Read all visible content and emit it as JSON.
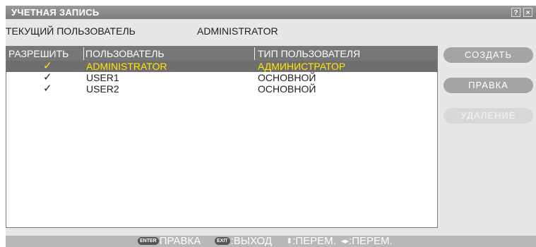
{
  "window": {
    "title": "УЧЕТНАЯ ЗАПИСЬ",
    "help_icon": "?",
    "close_icon": "×"
  },
  "current_user": {
    "label": "ТЕКУЩИЙ ПОЛЬЗОВАТЕЛЬ",
    "value": "ADMINISTRATOR"
  },
  "table": {
    "headers": [
      "РАЗРЕШИТЬ",
      "ПОЛЬЗОВАТЕЛЬ",
      "ТИП ПОЛЬЗОВАТЕЛЯ"
    ],
    "rows": [
      {
        "enabled": "✓",
        "user": "ADMINISTRATOR",
        "type": "АДМИНИСТРАТОР",
        "selected": true
      },
      {
        "enabled": "✓",
        "user": "USER1",
        "type": "ОСНОВНОЙ",
        "selected": false
      },
      {
        "enabled": "✓",
        "user": "USER2",
        "type": "ОСНОВНОЙ",
        "selected": false
      }
    ]
  },
  "buttons": {
    "create": "СОЗДАТЬ",
    "edit": "ПРАВКА",
    "delete": "УДАЛЕНИЕ"
  },
  "footer": {
    "enter_key": "ENTER",
    "enter_label": "ПРАВКА",
    "exit_key": "EXIT",
    "exit_label": ":ВЫХОД",
    "updown_glyph": "⬍",
    "updown_label": ":ПЕРЕМ.",
    "leftright_glyph": "◂▸",
    "leftright_label": ":ПЕРЕМ."
  }
}
